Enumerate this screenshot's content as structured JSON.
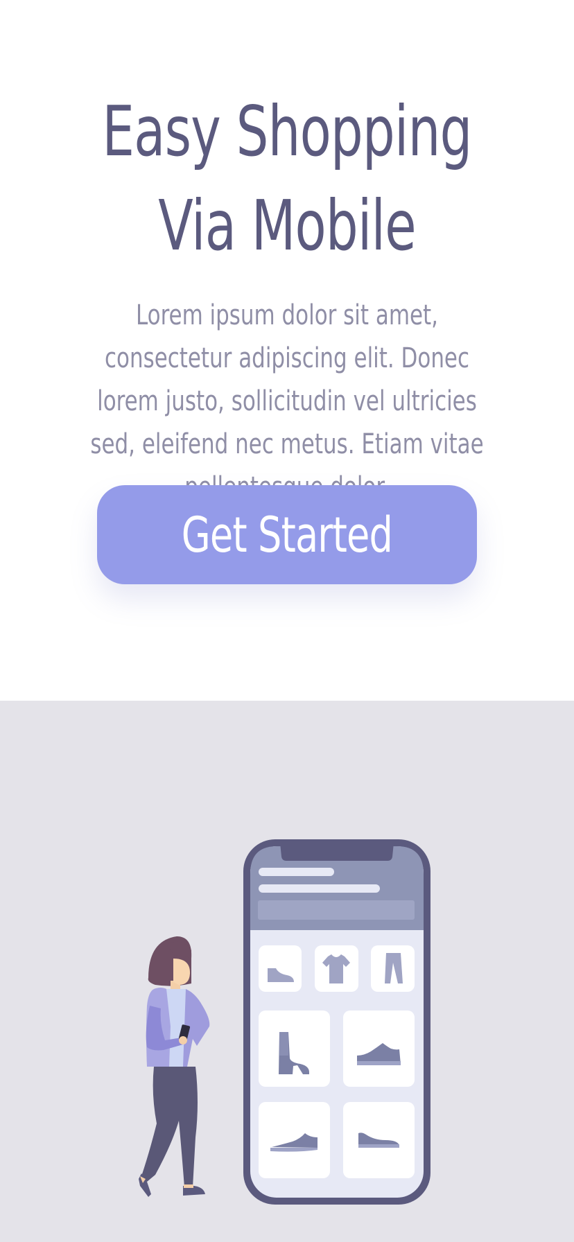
{
  "hero": {
    "headline_line1": "Easy Shopping",
    "headline_line2": "Via Mobile",
    "description": "Lorem ipsum dolor sit amet, consectetur adipiscing elit. Donec lorem justo, sollicitudin vel ultricies sed, eleifend nec metus. Etiam vitae pellentesque dolor.",
    "cta_label": "Get Started"
  },
  "colors": {
    "headline": "#5b5a7e",
    "body_text": "#8f8ea6",
    "button": "#949be9",
    "illustration_background": "#e4e3e9",
    "phone_frame": "#5b5a7e"
  },
  "illustration": {
    "icons": [
      "woman-figure",
      "smartphone-icon",
      "shoe-icon",
      "tshirt-icon",
      "pants-icon",
      "boot-icon",
      "sneaker-icon"
    ]
  }
}
